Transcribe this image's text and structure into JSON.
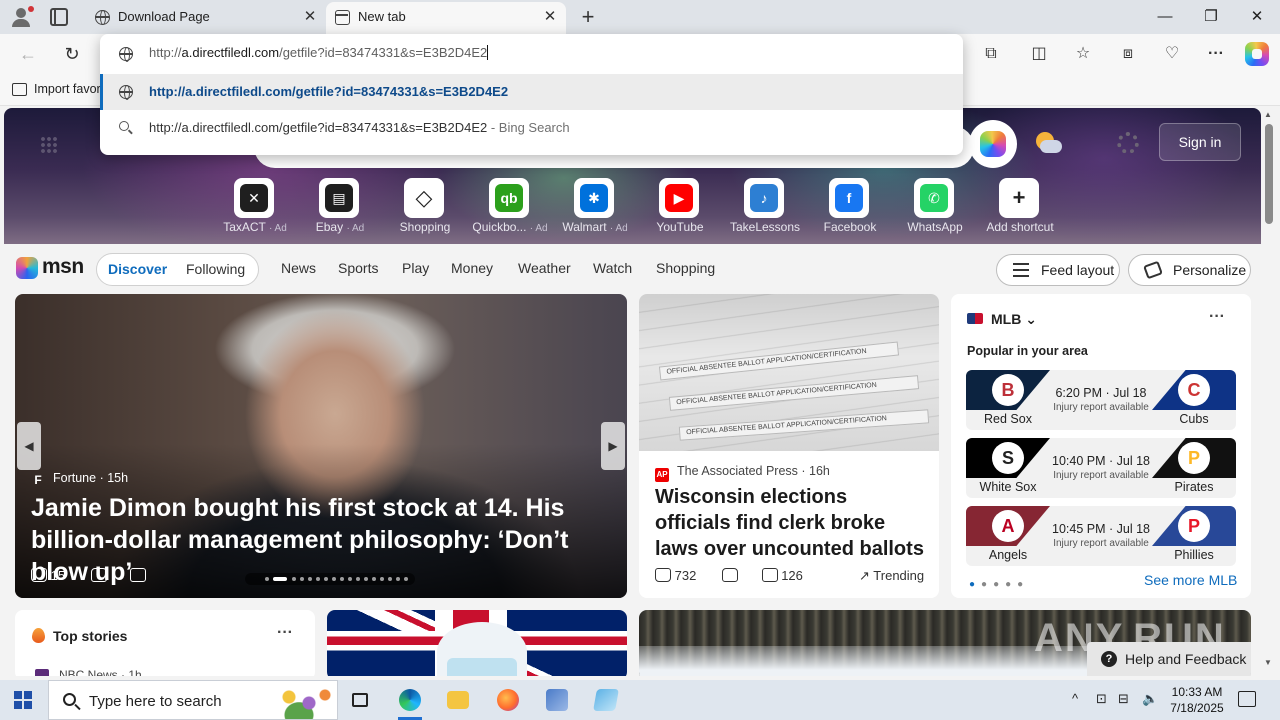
{
  "browser": {
    "tabs": [
      {
        "title": "Download Page",
        "active": false
      },
      {
        "title": "New tab",
        "active": true
      }
    ],
    "window_controls": {
      "minimize": "—",
      "maximize": "❐",
      "close": "✕"
    },
    "address": {
      "typed_prefix": "http://",
      "typed_host": "a.directfiledl.com",
      "typed_rest": "/getfile?id=83474331&s=E3B2D4E2",
      "suggestion_url": "http://a.directfiledl.com/getfile?id=83474331&s=E3B2D4E2",
      "bing_query": "http://a.directfiledl.com/getfile?id=83474331&s=E3B2D4E2",
      "bing_suffix": " - Bing Search"
    },
    "favorites_bar": {
      "import_label": "Import favor"
    },
    "accent": "#0f6cbd"
  },
  "msn": {
    "hero": {
      "sign_in": "Sign in"
    },
    "shortcuts": [
      {
        "label": "TaxACT",
        "ad": "· Ad",
        "icon": "taxact-icon",
        "color": "#1f1f1f",
        "glyph": "✕"
      },
      {
        "label": "Ebay",
        "ad": "· Ad",
        "icon": "ebay-icon",
        "color": "#1f1f1f",
        "glyph": "▤"
      },
      {
        "label": "Shopping",
        "ad": "",
        "icon": "shopping-tag-icon",
        "color": "#ffffff",
        "glyph": "◇"
      },
      {
        "label": "Quickbo...",
        "ad": "· Ad",
        "icon": "quickbooks-icon",
        "color": "#2ca01c",
        "glyph": "qb"
      },
      {
        "label": "Walmart",
        "ad": "· Ad",
        "icon": "walmart-icon",
        "color": "#0071dc",
        "glyph": "✱"
      },
      {
        "label": "YouTube",
        "ad": "",
        "icon": "youtube-icon",
        "color": "#ff0000",
        "glyph": "▶"
      },
      {
        "label": "TakeLessons",
        "ad": "",
        "icon": "takelessons-icon",
        "color": "#2d7fd3",
        "glyph": "♪"
      },
      {
        "label": "Facebook",
        "ad": "",
        "icon": "facebook-icon",
        "color": "#1877f2",
        "glyph": "f"
      },
      {
        "label": "WhatsApp",
        "ad": "",
        "icon": "whatsapp-icon",
        "color": "#25d366",
        "glyph": "✆"
      },
      {
        "label": "Add shortcut",
        "ad": "",
        "icon": "plus-icon",
        "color": "#ffffff",
        "glyph": "+"
      }
    ],
    "brand": "msn",
    "feed_tabs": {
      "discover": "Discover",
      "following": "Following"
    },
    "nav": [
      "News",
      "Sports",
      "Play",
      "Money",
      "Weather",
      "Watch",
      "Shopping"
    ],
    "feed_layout": "Feed layout",
    "personalize": "Personalize",
    "main_story": {
      "source": "Fortune",
      "age": "15h",
      "title": "Jamie Dimon bought his first stock at 14. His billion-dollar management philosophy: ‘Don’t blow up’",
      "likes": "15"
    },
    "news_story": {
      "image_text": [
        "OFFICIAL ABSENTEE BALLOT APPLICATION/CERTIFICATION",
        "OFFICIAL ABSENTEE BALLOT APPLICATION/CERTIFICATION",
        "OFFICIAL ABSENTEE BALLOT APPLICATION/CERTIFICATION"
      ],
      "source": "The Associated Press",
      "age": "16h",
      "title": "Wisconsin elections officials find clerk broke laws over uncounted ballots",
      "likes": "732",
      "comments": "126",
      "trending": "Trending"
    },
    "mlb": {
      "title": "MLB",
      "subtitle": "Popular in your area",
      "games": [
        {
          "home": "Red Sox",
          "away": "Cubs",
          "time": "6:20 PM · Jul 18",
          "note": "Injury report available",
          "home_color": "#0c2340",
          "away_color": "#0e3386",
          "home_glyph": "B",
          "away_glyph": "C",
          "home_glyph_color": "#bd3039",
          "away_glyph_color": "#cc3433"
        },
        {
          "home": "White Sox",
          "away": "Pirates",
          "time": "10:40 PM · Jul 18",
          "note": "Injury report available",
          "home_color": "#000000",
          "away_color": "#111111",
          "home_glyph": "S",
          "away_glyph": "P",
          "home_glyph_color": "#222222",
          "away_glyph_color": "#fdb827"
        },
        {
          "home": "Angels",
          "away": "Phillies",
          "time": "10:45 PM · Jul 18",
          "note": "Injury report available",
          "home_color": "#862633",
          "away_color": "#284898",
          "home_glyph": "A",
          "away_glyph": "P",
          "home_glyph_color": "#ba0021",
          "away_glyph_color": "#e81828"
        }
      ],
      "see_more": "See more MLB"
    },
    "top_stories": {
      "title": "Top stories",
      "source": "NBC News · 1h"
    },
    "watermark": "ANY.RUN",
    "help": "Help and Feedback"
  },
  "taskbar": {
    "search_placeholder": "Type here to search",
    "time": "10:33 AM",
    "date": "7/18/2025"
  }
}
